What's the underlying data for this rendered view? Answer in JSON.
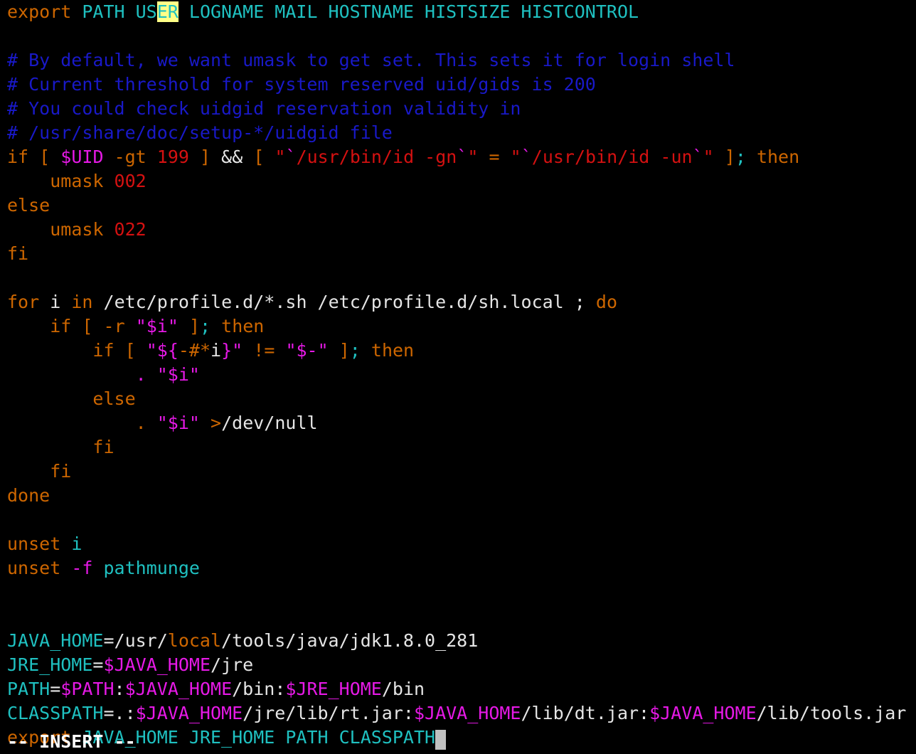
{
  "app": {
    "name": "vim",
    "mode_label": "-- INSERT --",
    "background": "#000000",
    "cursor_color": "#c0c0c0",
    "search_highlight_color": "#ffff87",
    "search_match_text": "ER"
  },
  "colors": {
    "keyword": "#cd6600",
    "comment": "#1919c8",
    "identifier": "#1fc0c0",
    "variable": "#e619e6",
    "string": "#d41111",
    "number": "#d41111",
    "normal": "#c5c8c6"
  },
  "buffer": {
    "lines": [
      {
        "n": 1,
        "text": "export PATH USER LOGNAME MAIL HOSTNAME HISTSIZE HISTCONTROL",
        "tokens": [
          {
            "t": "export",
            "c": "kw"
          },
          {
            "t": " ",
            "c": "plain"
          },
          {
            "t": "PATH US",
            "c": "ident"
          },
          {
            "t": "ER",
            "c": "search"
          },
          {
            "t": " LOGNAME MAIL HOSTNAME HISTSIZE HISTCONTROL",
            "c": "ident"
          }
        ]
      },
      {
        "n": 2,
        "text": "",
        "tokens": []
      },
      {
        "n": 3,
        "text": "# By default, we want umask to get set. This sets it for login shell",
        "tokens": [
          {
            "t": "# By default, we want umask to get set. This sets it for login shell",
            "c": "cmt"
          }
        ]
      },
      {
        "n": 4,
        "text": "# Current threshold for system reserved uid/gids is 200",
        "tokens": [
          {
            "t": "# Current threshold for system reserved uid/gids is 200",
            "c": "cmt"
          }
        ]
      },
      {
        "n": 5,
        "text": "# You could check uidgid reservation validity in",
        "tokens": [
          {
            "t": "# You could check uidgid reservation validity in",
            "c": "cmt"
          }
        ]
      },
      {
        "n": 6,
        "text": "# /usr/share/doc/setup-*/uidgid file",
        "tokens": [
          {
            "t": "# /usr/share/doc/setup-*/uidgid file",
            "c": "cmt"
          }
        ]
      },
      {
        "n": 7,
        "text": "if [ $UID -gt 199 ] && [ \"`/usr/bin/id -gn`\" = \"`/usr/bin/id -un`\" ]; then",
        "tokens": [
          {
            "t": "if",
            "c": "kw"
          },
          {
            "t": " ",
            "c": "plain"
          },
          {
            "t": "[",
            "c": "op"
          },
          {
            "t": " ",
            "c": "plain"
          },
          {
            "t": "$UID",
            "c": "var"
          },
          {
            "t": " ",
            "c": "plain"
          },
          {
            "t": "-gt",
            "c": "kw"
          },
          {
            "t": " ",
            "c": "plain"
          },
          {
            "t": "199",
            "c": "num"
          },
          {
            "t": " ",
            "c": "plain"
          },
          {
            "t": "]",
            "c": "op"
          },
          {
            "t": " ",
            "c": "plain"
          },
          {
            "t": "&&",
            "c": "white"
          },
          {
            "t": " ",
            "c": "plain"
          },
          {
            "t": "[",
            "c": "op"
          },
          {
            "t": " ",
            "c": "plain"
          },
          {
            "t": "\"",
            "c": "str"
          },
          {
            "t": "`",
            "c": "var"
          },
          {
            "t": "/usr/bin/id -gn",
            "c": "str"
          },
          {
            "t": "`",
            "c": "var"
          },
          {
            "t": "\"",
            "c": "str"
          },
          {
            "t": " ",
            "c": "plain"
          },
          {
            "t": "=",
            "c": "kw"
          },
          {
            "t": " ",
            "c": "plain"
          },
          {
            "t": "\"",
            "c": "str"
          },
          {
            "t": "`",
            "c": "var"
          },
          {
            "t": "/usr/bin/id -un",
            "c": "str"
          },
          {
            "t": "`",
            "c": "var"
          },
          {
            "t": "\"",
            "c": "str"
          },
          {
            "t": " ",
            "c": "plain"
          },
          {
            "t": "]",
            "c": "op"
          },
          {
            "t": ";",
            "c": "ident"
          },
          {
            "t": " ",
            "c": "plain"
          },
          {
            "t": "then",
            "c": "kw"
          }
        ]
      },
      {
        "n": 8,
        "text": "    umask 002",
        "tokens": [
          {
            "t": "    ",
            "c": "plain"
          },
          {
            "t": "umask",
            "c": "kw"
          },
          {
            "t": " ",
            "c": "plain"
          },
          {
            "t": "002",
            "c": "num"
          }
        ]
      },
      {
        "n": 9,
        "text": "else",
        "tokens": [
          {
            "t": "else",
            "c": "kw"
          }
        ]
      },
      {
        "n": 10,
        "text": "    umask 022",
        "tokens": [
          {
            "t": "    ",
            "c": "plain"
          },
          {
            "t": "umask",
            "c": "kw"
          },
          {
            "t": " ",
            "c": "plain"
          },
          {
            "t": "022",
            "c": "num"
          }
        ]
      },
      {
        "n": 11,
        "text": "fi",
        "tokens": [
          {
            "t": "fi",
            "c": "kw"
          }
        ]
      },
      {
        "n": 12,
        "text": "",
        "tokens": []
      },
      {
        "n": 13,
        "text": "for i in /etc/profile.d/*.sh /etc/profile.d/sh.local ; do",
        "tokens": [
          {
            "t": "for",
            "c": "kw"
          },
          {
            "t": " ",
            "c": "plain"
          },
          {
            "t": "i",
            "c": "white"
          },
          {
            "t": " ",
            "c": "plain"
          },
          {
            "t": "in",
            "c": "kw"
          },
          {
            "t": " ",
            "c": "plain"
          },
          {
            "t": "/etc/profile.d/*.sh /etc/profile.d/sh.local ;",
            "c": "white"
          },
          {
            "t": " ",
            "c": "plain"
          },
          {
            "t": "do",
            "c": "kw"
          }
        ]
      },
      {
        "n": 14,
        "text": "    if [ -r \"$i\" ]; then",
        "tokens": [
          {
            "t": "    ",
            "c": "plain"
          },
          {
            "t": "if",
            "c": "kw"
          },
          {
            "t": " ",
            "c": "plain"
          },
          {
            "t": "[",
            "c": "op"
          },
          {
            "t": " ",
            "c": "plain"
          },
          {
            "t": "-r",
            "c": "kw"
          },
          {
            "t": " ",
            "c": "plain"
          },
          {
            "t": "\"$i\"",
            "c": "var"
          },
          {
            "t": " ",
            "c": "plain"
          },
          {
            "t": "]",
            "c": "op"
          },
          {
            "t": ";",
            "c": "ident"
          },
          {
            "t": " ",
            "c": "plain"
          },
          {
            "t": "then",
            "c": "kw"
          }
        ]
      },
      {
        "n": 15,
        "text": "        if [ \"${-#*i}\" != \"$-\" ]; then",
        "tokens": [
          {
            "t": "        ",
            "c": "plain"
          },
          {
            "t": "if",
            "c": "kw"
          },
          {
            "t": " ",
            "c": "plain"
          },
          {
            "t": "[",
            "c": "op"
          },
          {
            "t": " ",
            "c": "plain"
          },
          {
            "t": "\"${",
            "c": "var"
          },
          {
            "t": "-#*",
            "c": "kw"
          },
          {
            "t": "i",
            "c": "white"
          },
          {
            "t": "}\"",
            "c": "var"
          },
          {
            "t": " ",
            "c": "plain"
          },
          {
            "t": "!=",
            "c": "kw"
          },
          {
            "t": " ",
            "c": "plain"
          },
          {
            "t": "\"$-\"",
            "c": "var"
          },
          {
            "t": " ",
            "c": "plain"
          },
          {
            "t": "]",
            "c": "op"
          },
          {
            "t": ";",
            "c": "ident"
          },
          {
            "t": " ",
            "c": "plain"
          },
          {
            "t": "then",
            "c": "kw"
          }
        ]
      },
      {
        "n": 16,
        "text": "            . \"$i\"",
        "tokens": [
          {
            "t": "            ",
            "c": "plain"
          },
          {
            "t": ".",
            "c": "var"
          },
          {
            "t": " ",
            "c": "plain"
          },
          {
            "t": "\"$i\"",
            "c": "var"
          }
        ]
      },
      {
        "n": 17,
        "text": "        else",
        "tokens": [
          {
            "t": "        ",
            "c": "plain"
          },
          {
            "t": "else",
            "c": "kw"
          }
        ]
      },
      {
        "n": 18,
        "text": "            . \"$i\" >/dev/null",
        "tokens": [
          {
            "t": "            ",
            "c": "plain"
          },
          {
            "t": ".",
            "c": "kw"
          },
          {
            "t": " ",
            "c": "plain"
          },
          {
            "t": "\"$i\"",
            "c": "var"
          },
          {
            "t": " ",
            "c": "plain"
          },
          {
            "t": ">",
            "c": "kw"
          },
          {
            "t": "/dev/null",
            "c": "white"
          }
        ]
      },
      {
        "n": 19,
        "text": "        fi",
        "tokens": [
          {
            "t": "        ",
            "c": "plain"
          },
          {
            "t": "fi",
            "c": "kw"
          }
        ]
      },
      {
        "n": 20,
        "text": "    fi",
        "tokens": [
          {
            "t": "    ",
            "c": "plain"
          },
          {
            "t": "fi",
            "c": "kw"
          }
        ]
      },
      {
        "n": 21,
        "text": "done",
        "tokens": [
          {
            "t": "done",
            "c": "kw"
          }
        ]
      },
      {
        "n": 22,
        "text": "",
        "tokens": []
      },
      {
        "n": 23,
        "text": "unset i",
        "tokens": [
          {
            "t": "unset",
            "c": "kw"
          },
          {
            "t": " ",
            "c": "plain"
          },
          {
            "t": "i",
            "c": "ident"
          }
        ]
      },
      {
        "n": 24,
        "text": "unset -f pathmunge",
        "tokens": [
          {
            "t": "unset",
            "c": "kw"
          },
          {
            "t": " ",
            "c": "plain"
          },
          {
            "t": "-f",
            "c": "var"
          },
          {
            "t": " ",
            "c": "plain"
          },
          {
            "t": "pathmunge",
            "c": "ident"
          }
        ]
      },
      {
        "n": 25,
        "text": "",
        "tokens": []
      },
      {
        "n": 26,
        "text": "",
        "tokens": []
      },
      {
        "n": 27,
        "text": "JAVA_HOME=/usr/local/tools/java/jdk1.8.0_281",
        "tokens": [
          {
            "t": "JAVA_HOME",
            "c": "ident"
          },
          {
            "t": "=/usr/",
            "c": "white"
          },
          {
            "t": "local",
            "c": "kw"
          },
          {
            "t": "/tools/java/jdk1.8.0_281",
            "c": "white"
          }
        ]
      },
      {
        "n": 28,
        "text": "JRE_HOME=$JAVA_HOME/jre",
        "tokens": [
          {
            "t": "JRE_HOME",
            "c": "ident"
          },
          {
            "t": "=",
            "c": "white"
          },
          {
            "t": "$JAVA_HOME",
            "c": "var"
          },
          {
            "t": "/jre",
            "c": "white"
          }
        ]
      },
      {
        "n": 29,
        "text": "PATH=$PATH:$JAVA_HOME/bin:$JRE_HOME/bin",
        "tokens": [
          {
            "t": "PATH",
            "c": "ident"
          },
          {
            "t": "=",
            "c": "white"
          },
          {
            "t": "$PATH",
            "c": "var"
          },
          {
            "t": ":",
            "c": "white"
          },
          {
            "t": "$JAVA_HOME",
            "c": "var"
          },
          {
            "t": "/bin:",
            "c": "white"
          },
          {
            "t": "$JRE_HOME",
            "c": "var"
          },
          {
            "t": "/bin",
            "c": "white"
          }
        ]
      },
      {
        "n": 30,
        "text": "CLASSPATH=.:$JAVA_HOME/jre/lib/rt.jar:$JAVA_HOME/lib/dt.jar:$JAVA_HOME/lib/tools.jar",
        "tokens": [
          {
            "t": "CLASSPATH",
            "c": "ident"
          },
          {
            "t": "=.:",
            "c": "white"
          },
          {
            "t": "$JAVA_HOME",
            "c": "var"
          },
          {
            "t": "/jre/lib/rt.jar:",
            "c": "white"
          },
          {
            "t": "$JAVA_HOME",
            "c": "var"
          },
          {
            "t": "/lib/dt.jar:",
            "c": "white"
          },
          {
            "t": "$JAVA_HOME",
            "c": "var"
          },
          {
            "t": "/lib/tools.jar",
            "c": "white"
          }
        ]
      },
      {
        "n": 31,
        "text": "export JAVA_HOME JRE_HOME PATH CLASSPATH",
        "cursor_after": true,
        "tokens": [
          {
            "t": "export",
            "c": "kw"
          },
          {
            "t": " ",
            "c": "plain"
          },
          {
            "t": "JAVA_HOME JRE_HOME PATH CLASSPATH",
            "c": "ident"
          }
        ]
      }
    ]
  }
}
